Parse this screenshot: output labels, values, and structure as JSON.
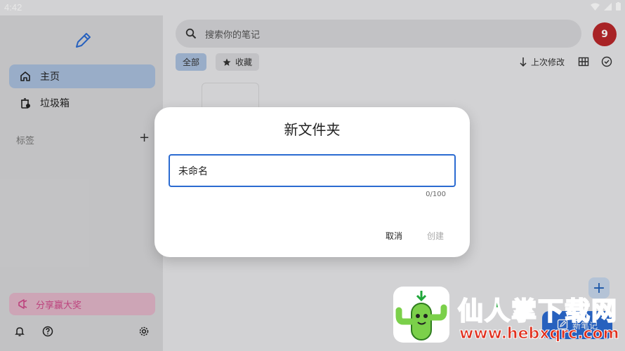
{
  "status_bar": {
    "time": "4:42"
  },
  "sidebar": {
    "items": [
      {
        "label": "主页",
        "icon": "home-icon",
        "selected": true
      },
      {
        "label": "垃圾箱",
        "icon": "trash-icon",
        "selected": false
      }
    ],
    "tags_label": "标签",
    "share_label": "分享赢大奖"
  },
  "header": {
    "search_placeholder": "搜索你的笔记",
    "avatar_text": "9"
  },
  "filters": {
    "all_label": "全部",
    "favorites_label": "收藏",
    "sort_label": "上次修改"
  },
  "fab": {
    "new_note_label": "新笔记"
  },
  "dialog": {
    "title": "新文件夹",
    "input_value": "未命名",
    "counter": "0/100",
    "cancel_label": "取消",
    "create_label": "创建"
  },
  "watermark": {
    "title": "仙人掌下载网",
    "url": "www.hebxqrc.com"
  },
  "colors": {
    "accent": "#2b6bd1",
    "selected_bg": "#a9bfdc",
    "avatar": "#b9272a",
    "share_text": "#d04a8a",
    "watermark_green": "#1fa63a",
    "watermark_red": "#e0301e"
  }
}
